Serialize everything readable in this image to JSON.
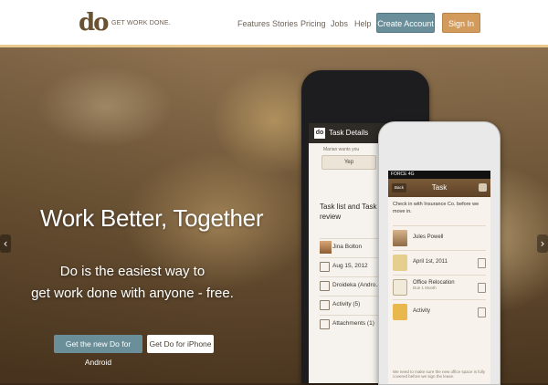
{
  "brand": {
    "logo_text": "do",
    "tagline": "GET WORK DONE."
  },
  "nav": {
    "links": [
      "Features",
      "Stories",
      "Pricing",
      "Jobs",
      "Help"
    ],
    "create_account": "Create Account",
    "sign_in": "Sign In"
  },
  "hero": {
    "headline": "Work Better, Together",
    "subline_1": "Do is the easiest way to",
    "subline_2": "get work done with anyone - free.",
    "cta_android": "Get the new Do for Android",
    "cta_iphone": "Get Do for iPhone"
  },
  "android_app": {
    "logo": "do",
    "header_title": "Task Details",
    "note": "Marian wants you",
    "yep_label": "Yep",
    "task_title": "Task list and Task create review",
    "rows": [
      "Jina Bolton",
      "Aug 15, 2012",
      "Droideka (Andro...",
      "Activity (5)",
      "Attachments (1)"
    ]
  },
  "iphone_app": {
    "status": "FORCE 4G",
    "back_label": "Back",
    "header_title": "Task",
    "description": "Check in with Insurance Co. before we move in.",
    "rows": [
      {
        "label": "Jules Powell",
        "sub": ""
      },
      {
        "label": "April 1st, 2011",
        "sub": ""
      },
      {
        "label": "Office Relocation",
        "sub": "Due 1 Month"
      },
      {
        "label": "Activity",
        "sub": ""
      }
    ],
    "footer": "We need to make sure the new office space is fully covered before we sign the lease."
  },
  "colors": {
    "brand_brown": "#6a5130",
    "create_account_bg": "#6a8f9a",
    "sign_in_bg": "#d29b5c",
    "hero_overlay": "#6e5536"
  },
  "icons": [
    "arrow-left-icon",
    "arrow-right-icon",
    "calendar-icon",
    "checkbox-icon",
    "activity-icon",
    "attachment-icon",
    "chat-icon"
  ]
}
